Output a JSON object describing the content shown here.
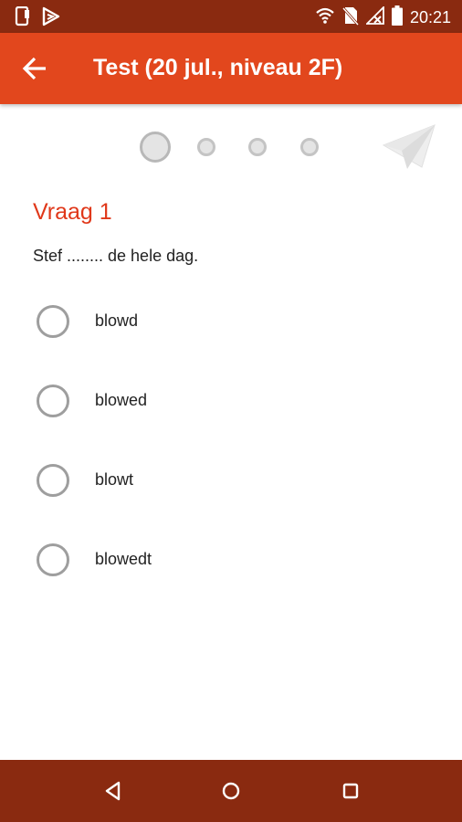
{
  "status_bar": {
    "time": "20:21",
    "left_icons": [
      "phone-icon",
      "play-store-icon"
    ],
    "right_icons": [
      "wifi-icon",
      "no-sim-icon",
      "no-signal-icon",
      "battery-icon"
    ]
  },
  "app_bar": {
    "title": "Test (20 jul., niveau 2F)",
    "back_icon": "arrow-left-icon"
  },
  "progress": {
    "total_steps": 4,
    "current_step": 1,
    "send_icon": "paper-plane-icon"
  },
  "question": {
    "title": "Vraag 1",
    "text": "Stef ........ de hele dag.",
    "options": [
      {
        "label": "blowd",
        "selected": false
      },
      {
        "label": "blowed",
        "selected": false
      },
      {
        "label": "blowt",
        "selected": false
      },
      {
        "label": "blowedt",
        "selected": false
      }
    ]
  },
  "nav_bar": {
    "buttons": [
      "back-triangle-icon",
      "home-circle-icon",
      "recents-square-icon"
    ]
  },
  "colors": {
    "status_bar": "#8a2a10",
    "app_bar": "#e2471d",
    "question_title": "#e0381a",
    "nav_bar": "#8a2a10"
  }
}
